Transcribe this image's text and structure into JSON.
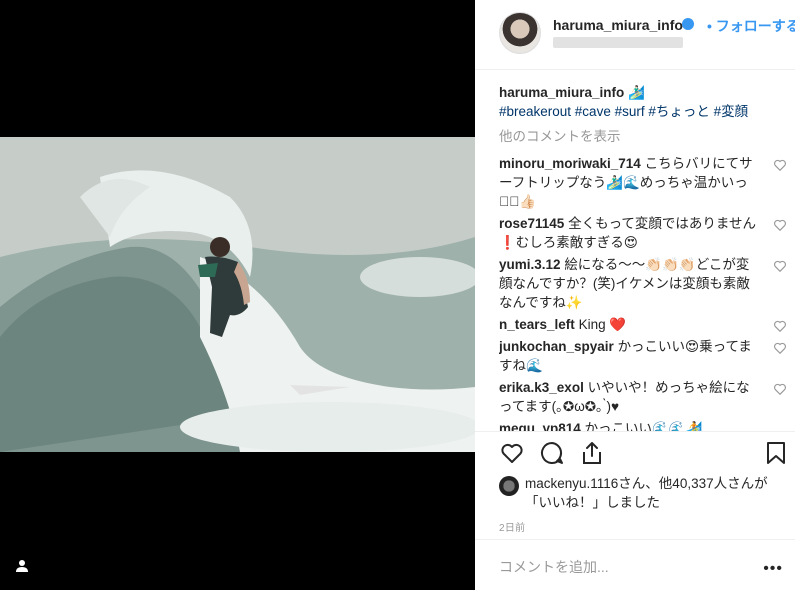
{
  "post": {
    "username": "haruma_miura_info",
    "follow_label": "• フォローする"
  },
  "caption": {
    "username": "haruma_miura_info",
    "emoji": "🏄🏻‍♂️",
    "hashtags": "#breakerout #cave #surf #ちょっと #変顔"
  },
  "view_more": "他のコメントを表示",
  "comments": [
    {
      "user": "minoru_moriwaki_714",
      "text": "こちらバリにてサーフトリップなう🏄🏻‍♂️🌊めっちゃ温かいっす🏻👍🏻"
    },
    {
      "user": "rose71145",
      "text": "全くもって変顔ではありません❗むしろ素敵すぎる😍"
    },
    {
      "user": "yumi.3.12",
      "text": "絵になる〜〜👏🏻👏🏻👏🏻どこが変顔なんですか？(笑)イケメンは変顔も素敵なんですね✨"
    },
    {
      "user": "n_tears_left",
      "text": "King ❤️"
    },
    {
      "user": "junkochan_spyair",
      "text": "かっこいい😍乗ってますね🌊"
    },
    {
      "user": "erika.k3_exol",
      "text": "いやいや！めっちゃ絵になってます(｡✪ω✪｡ ̀)♥"
    },
    {
      "user": "megu_yp814",
      "text": "かっこいい🌊🌊🏄"
    }
  ],
  "likes": {
    "text": "mackenyu.1116さん、他40,337人さんが「いいね！」しました"
  },
  "time": "2日前",
  "add_comment_placeholder": "コメントを追加...",
  "more_label": "•••",
  "icons": {
    "like": "heart-icon",
    "comment": "comment-icon",
    "share": "share-icon",
    "save": "bookmark-icon",
    "tag": "user-tag-icon"
  }
}
